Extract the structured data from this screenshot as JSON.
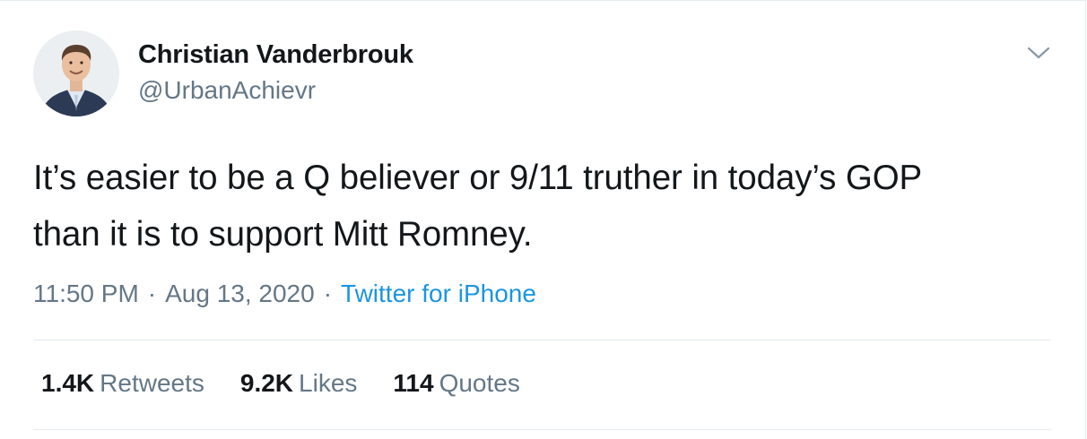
{
  "tweet": {
    "author": {
      "display_name": "Christian Vanderbrouk",
      "handle": "@UrbanAchievr",
      "avatar_icon": "profile-photo"
    },
    "text": "It’s easier to be a Q believer or 9/11 truther in today’s GOP\nthan it is to support Mitt Romney.",
    "meta": {
      "time": "11:50 PM",
      "separator": "·",
      "date": "Aug 13, 2020",
      "source": "Twitter for iPhone"
    },
    "stats": {
      "retweets": {
        "count": "1.4K",
        "label": "Retweets"
      },
      "likes": {
        "count": "9.2K",
        "label": "Likes"
      },
      "quotes": {
        "count": "114",
        "label": "Quotes"
      }
    },
    "menu_icon": "chevron-down-icon"
  },
  "colors": {
    "text_primary": "#14171a",
    "text_secondary": "#657786",
    "link": "#1b95e0",
    "divider": "#e6ecf0"
  }
}
